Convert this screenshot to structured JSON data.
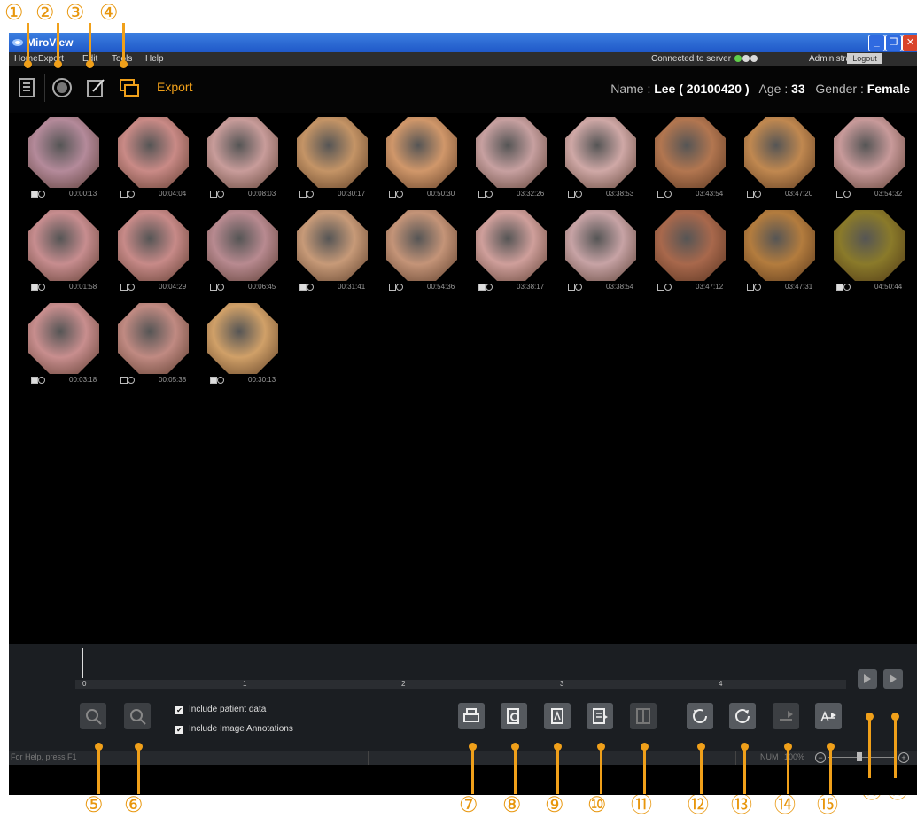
{
  "annotations": [
    "①",
    "②",
    "③",
    "④",
    "⑤",
    "⑥",
    "⑦",
    "⑧",
    "⑨",
    "⑩",
    "⑪",
    "⑫",
    "⑬",
    "⑭",
    "⑮",
    "⑯",
    "⑰"
  ],
  "window": {
    "title": "MiroView",
    "menu": [
      "Home",
      "Export",
      "Edit",
      "Tools",
      "Help"
    ],
    "connection_text": "Connected to server",
    "connection_dots": [
      "#5fcf4a",
      "#d9d9d9",
      "#d9d9d9"
    ],
    "user": "Administrator",
    "logout_label": "Logout"
  },
  "toolbar": {
    "icons": [
      "report-list-icon",
      "capture-icon",
      "edit-note-icon",
      "export-icon"
    ],
    "mode_label": "Export"
  },
  "patient": {
    "name_label": "Name :",
    "name": "Lee ( 20100420 )",
    "age_label": "Age :",
    "age": "33",
    "gender_label": "Gender :",
    "gender": "Female"
  },
  "thumbnails": [
    {
      "time": "00:00:13",
      "checked": true,
      "color": "#b48a9a"
    },
    {
      "time": "00:04:04",
      "checked": false,
      "color": "#c98a86"
    },
    {
      "time": "00:08:03",
      "checked": false,
      "color": "#c89c9a"
    },
    {
      "time": "00:30:17",
      "checked": false,
      "color": "#c49466"
    },
    {
      "time": "00:50:30",
      "checked": false,
      "color": "#d0976a"
    },
    {
      "time": "03:32:26",
      "checked": false,
      "color": "#c7a0a0"
    },
    {
      "time": "03:38:53",
      "checked": false,
      "color": "#cfa8a6"
    },
    {
      "time": "03:43:54",
      "checked": false,
      "color": "#b27650"
    },
    {
      "time": "03:47:20",
      "checked": false,
      "color": "#c08850"
    },
    {
      "time": "03:54:32",
      "checked": false,
      "color": "#c89a9a"
    },
    {
      "time": "00:01:58",
      "checked": true,
      "color": "#c78d8f"
    },
    {
      "time": "00:04:29",
      "checked": false,
      "color": "#c78a88"
    },
    {
      "time": "00:06:45",
      "checked": false,
      "color": "#b88a90"
    },
    {
      "time": "00:31:41",
      "checked": true,
      "color": "#c79a78"
    },
    {
      "time": "00:54:36",
      "checked": false,
      "color": "#c49478"
    },
    {
      "time": "03:38:17",
      "checked": true,
      "color": "#cf9f9b"
    },
    {
      "time": "03:38:54",
      "checked": false,
      "color": "#c7a3a5"
    },
    {
      "time": "03:47:12",
      "checked": false,
      "color": "#a8684c"
    },
    {
      "time": "03:47:31",
      "checked": false,
      "color": "#b37c3e"
    },
    {
      "time": "04:50:44",
      "checked": true,
      "color": "#8a7a2a"
    },
    {
      "time": "00:03:18",
      "checked": true,
      "color": "#c88e8e"
    },
    {
      "time": "00:05:38",
      "checked": false,
      "color": "#c08a82"
    },
    {
      "time": "00:30:13",
      "checked": true,
      "color": "#d0a068"
    }
  ],
  "timeline": {
    "labels": [
      "0",
      "1",
      "2",
      "3",
      "4"
    ]
  },
  "options": {
    "include_patient_data": "Include patient data",
    "include_image_annotations": "Include Image Annotations"
  },
  "buttons": {
    "left": [
      "zoom-in-icon",
      "zoom-out-icon"
    ],
    "right": [
      "print-icon",
      "print-preview-icon",
      "pdf-icon",
      "export-document-icon",
      "split-view-icon",
      "rotate-left-icon",
      "rotate-right-icon",
      "move-right-icon",
      "text-arrow-icon"
    ],
    "nav": [
      "prev-arrow-icon",
      "next-arrow-icon"
    ]
  },
  "status": {
    "help_text": "For Help, press F1",
    "num": "NUM",
    "zoom": "100%"
  }
}
